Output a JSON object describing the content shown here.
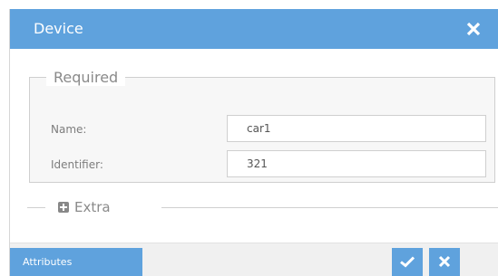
{
  "dialog": {
    "title": "Device",
    "close_icon": "close-icon"
  },
  "required": {
    "legend": "Required",
    "fields": [
      {
        "label": "Name:",
        "value": "car1"
      },
      {
        "label": "Identifier:",
        "value": "321"
      }
    ]
  },
  "extra": {
    "label": "Extra",
    "icon": "plus-square-icon"
  },
  "footer": {
    "attributes_label": "Attributes",
    "save_icon": "check-icon",
    "cancel_icon": "close-icon"
  },
  "colors": {
    "accent": "#5fa2dd",
    "background": "#ffffff",
    "fieldset_bg": "#f7f7f7",
    "footer_bg": "#f0f0f0"
  }
}
